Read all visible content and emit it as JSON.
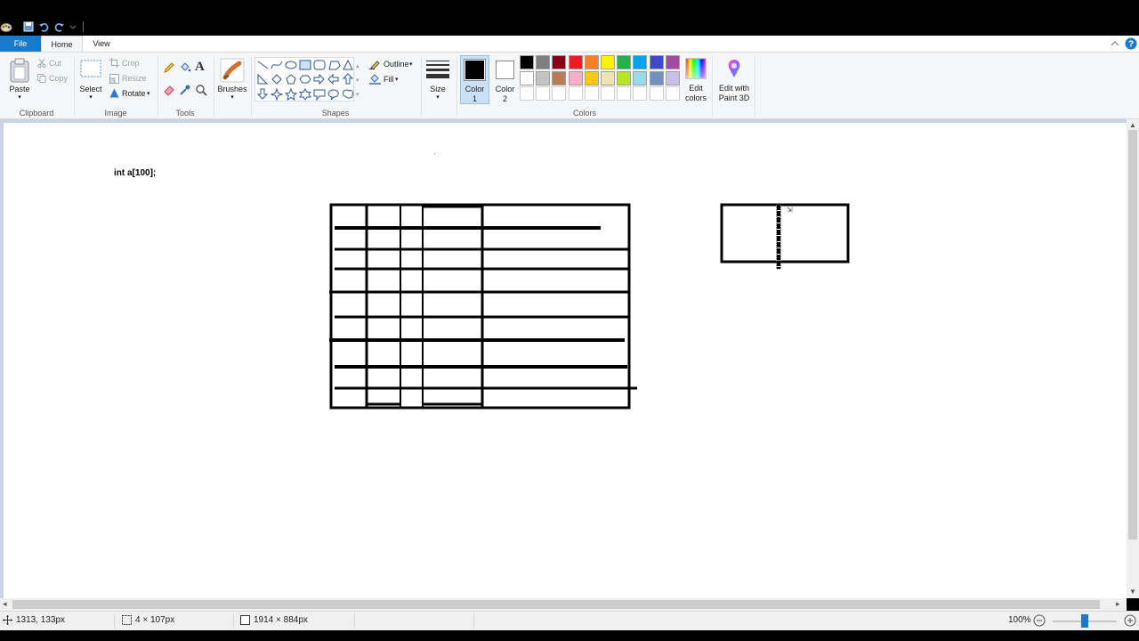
{
  "tabs": {
    "file": "File",
    "home": "Home",
    "view": "View"
  },
  "clipboard": {
    "paste": "Paste",
    "cut": "Cut",
    "copy": "Copy",
    "label": "Clipboard"
  },
  "image": {
    "select": "Select",
    "crop": "Crop",
    "resize": "Resize",
    "rotate": "Rotate",
    "label": "Image"
  },
  "tools": {
    "label": "Tools"
  },
  "brushes": {
    "label": "Brushes"
  },
  "shapes": {
    "outline": "Outline",
    "fill": "Fill",
    "label": "Shapes"
  },
  "size": {
    "label": "Size"
  },
  "colors": {
    "color1_label": "Color",
    "color1_num": "1",
    "color2_label": "Color",
    "color2_num": "2",
    "edit_colors_line1": "Edit",
    "edit_colors_line2": "colors",
    "edit_paint3d_line1": "Edit with",
    "edit_paint3d_line2": "Paint 3D",
    "label": "Colors",
    "color1_value": "#000000",
    "color2_value": "#ffffff",
    "palette_row1": [
      "#000000",
      "#7f7f7f",
      "#880015",
      "#ed1c24",
      "#ff7f27",
      "#fff200",
      "#22b14c",
      "#00a2e8",
      "#3f48cc",
      "#a349a4"
    ],
    "palette_row2": [
      "#ffffff",
      "#c3c3c3",
      "#b97a57",
      "#ffaec9",
      "#ffc90e",
      "#efe4b0",
      "#b5e61d",
      "#99d9ea",
      "#7092be",
      "#c8bfe7"
    ],
    "palette_row3": [
      "#ffffff",
      "#ffffff",
      "#ffffff",
      "#ffffff",
      "#ffffff",
      "#ffffff",
      "#ffffff",
      "#ffffff",
      "#ffffff",
      "#ffffff"
    ]
  },
  "canvas": {
    "text": "int a[100];"
  },
  "status": {
    "cursor_pos": "1313, 133px",
    "selection_size": "4 × 107px",
    "image_size": "1914 × 884px",
    "zoom": "100%",
    "zoom_level": 0.5
  },
  "accent": "#1979ca"
}
